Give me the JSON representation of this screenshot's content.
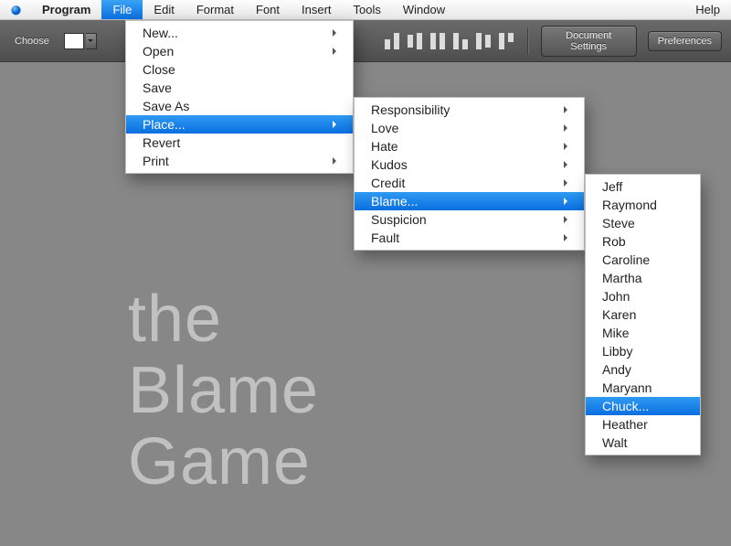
{
  "menubar": {
    "program": "Program",
    "items": [
      "File",
      "Edit",
      "Format",
      "Font",
      "Insert",
      "Tools",
      "Window"
    ],
    "help": "Help",
    "open_index": 0
  },
  "toolbar": {
    "choose_label": "Choose",
    "doc_settings": "Document Settings",
    "preferences": "Preferences"
  },
  "file_menu": {
    "items": [
      {
        "label": "New...",
        "sub": true
      },
      {
        "label": "Open",
        "sub": true
      },
      {
        "label": "Close"
      },
      {
        "label": "Save"
      },
      {
        "label": "Save As"
      },
      {
        "label": "Place...",
        "sub": true,
        "hl": true
      },
      {
        "label": "Revert"
      },
      {
        "label": "Print",
        "sub": true
      }
    ]
  },
  "place_menu": {
    "items": [
      {
        "label": "Responsibility",
        "sub": true
      },
      {
        "label": "Love",
        "sub": true
      },
      {
        "label": "Hate",
        "sub": true
      },
      {
        "label": "Kudos",
        "sub": true
      },
      {
        "label": "Credit",
        "sub": true
      },
      {
        "label": "Blame...",
        "sub": true,
        "hl": true
      },
      {
        "label": "Suspicion",
        "sub": true
      },
      {
        "label": "Fault",
        "sub": true
      }
    ]
  },
  "blame_menu": {
    "items": [
      {
        "label": "Jeff"
      },
      {
        "label": "Raymond"
      },
      {
        "label": "Steve"
      },
      {
        "label": "Rob"
      },
      {
        "label": "Caroline"
      },
      {
        "label": "Martha"
      },
      {
        "label": "John"
      },
      {
        "label": "Karen"
      },
      {
        "label": "Mike"
      },
      {
        "label": "Libby"
      },
      {
        "label": "Andy"
      },
      {
        "label": "Maryann"
      },
      {
        "label": "Chuck...",
        "hl": true
      },
      {
        "label": "Heather"
      },
      {
        "label": "Walt"
      }
    ]
  },
  "title": {
    "line1": "the",
    "line2": "Blame",
    "line3": "Game"
  }
}
